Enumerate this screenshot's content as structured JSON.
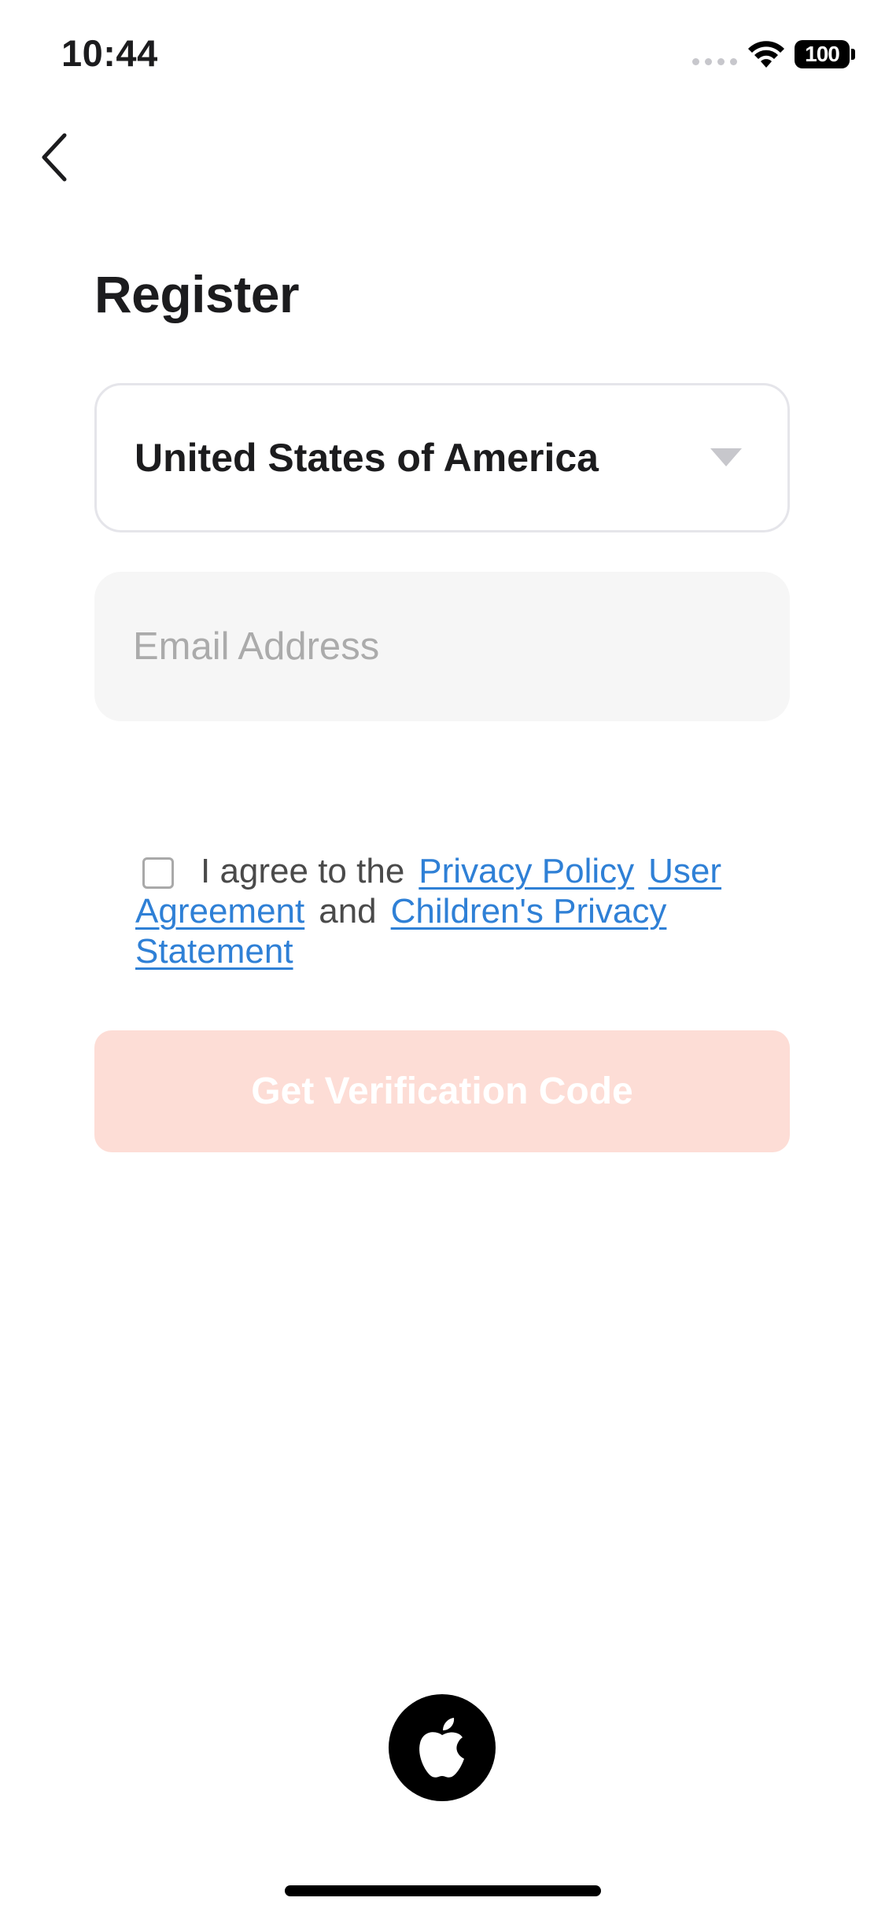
{
  "status_bar": {
    "time": "10:44",
    "battery": "100"
  },
  "header": {
    "title": "Register"
  },
  "form": {
    "country": "United States of America",
    "email_placeholder": "Email Address",
    "email_value": ""
  },
  "agreement": {
    "prefix": "I agree to the",
    "privacy_policy": "Privacy Policy",
    "user_agreement": "User Agreement",
    "conjunction": "and",
    "childrens_privacy": "Children's Privacy Statement",
    "checked": false
  },
  "actions": {
    "verify_label": "Get Verification Code",
    "verify_bg": "#fdddd6",
    "link_color": "#2f80d6"
  },
  "icons": {
    "back": "chevron-left-icon",
    "dropdown": "caret-down-icon",
    "apple": "apple-logo-icon",
    "wifi": "wifi-icon"
  }
}
